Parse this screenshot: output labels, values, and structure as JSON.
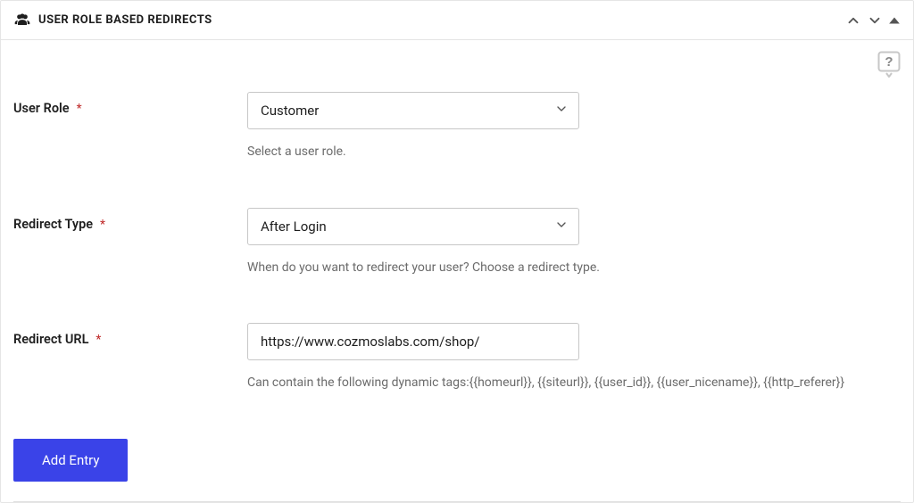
{
  "panel": {
    "title": "USER ROLE BASED REDIRECTS"
  },
  "fields": {
    "user_role": {
      "label": "User Role",
      "required": "*",
      "value": "Customer",
      "help": "Select a user role."
    },
    "redirect_type": {
      "label": "Redirect Type",
      "required": "*",
      "value": "After Login",
      "help": "When do you want to redirect your user? Choose a redirect type."
    },
    "redirect_url": {
      "label": "Redirect URL",
      "required": "*",
      "value": "https://www.cozmoslabs.com/shop/",
      "help": "Can contain the following dynamic tags:{{homeurl}}, {{siteurl}}, {{user_id}}, {{user_nicename}}, {{http_referer}}"
    }
  },
  "actions": {
    "add_entry": "Add Entry"
  }
}
